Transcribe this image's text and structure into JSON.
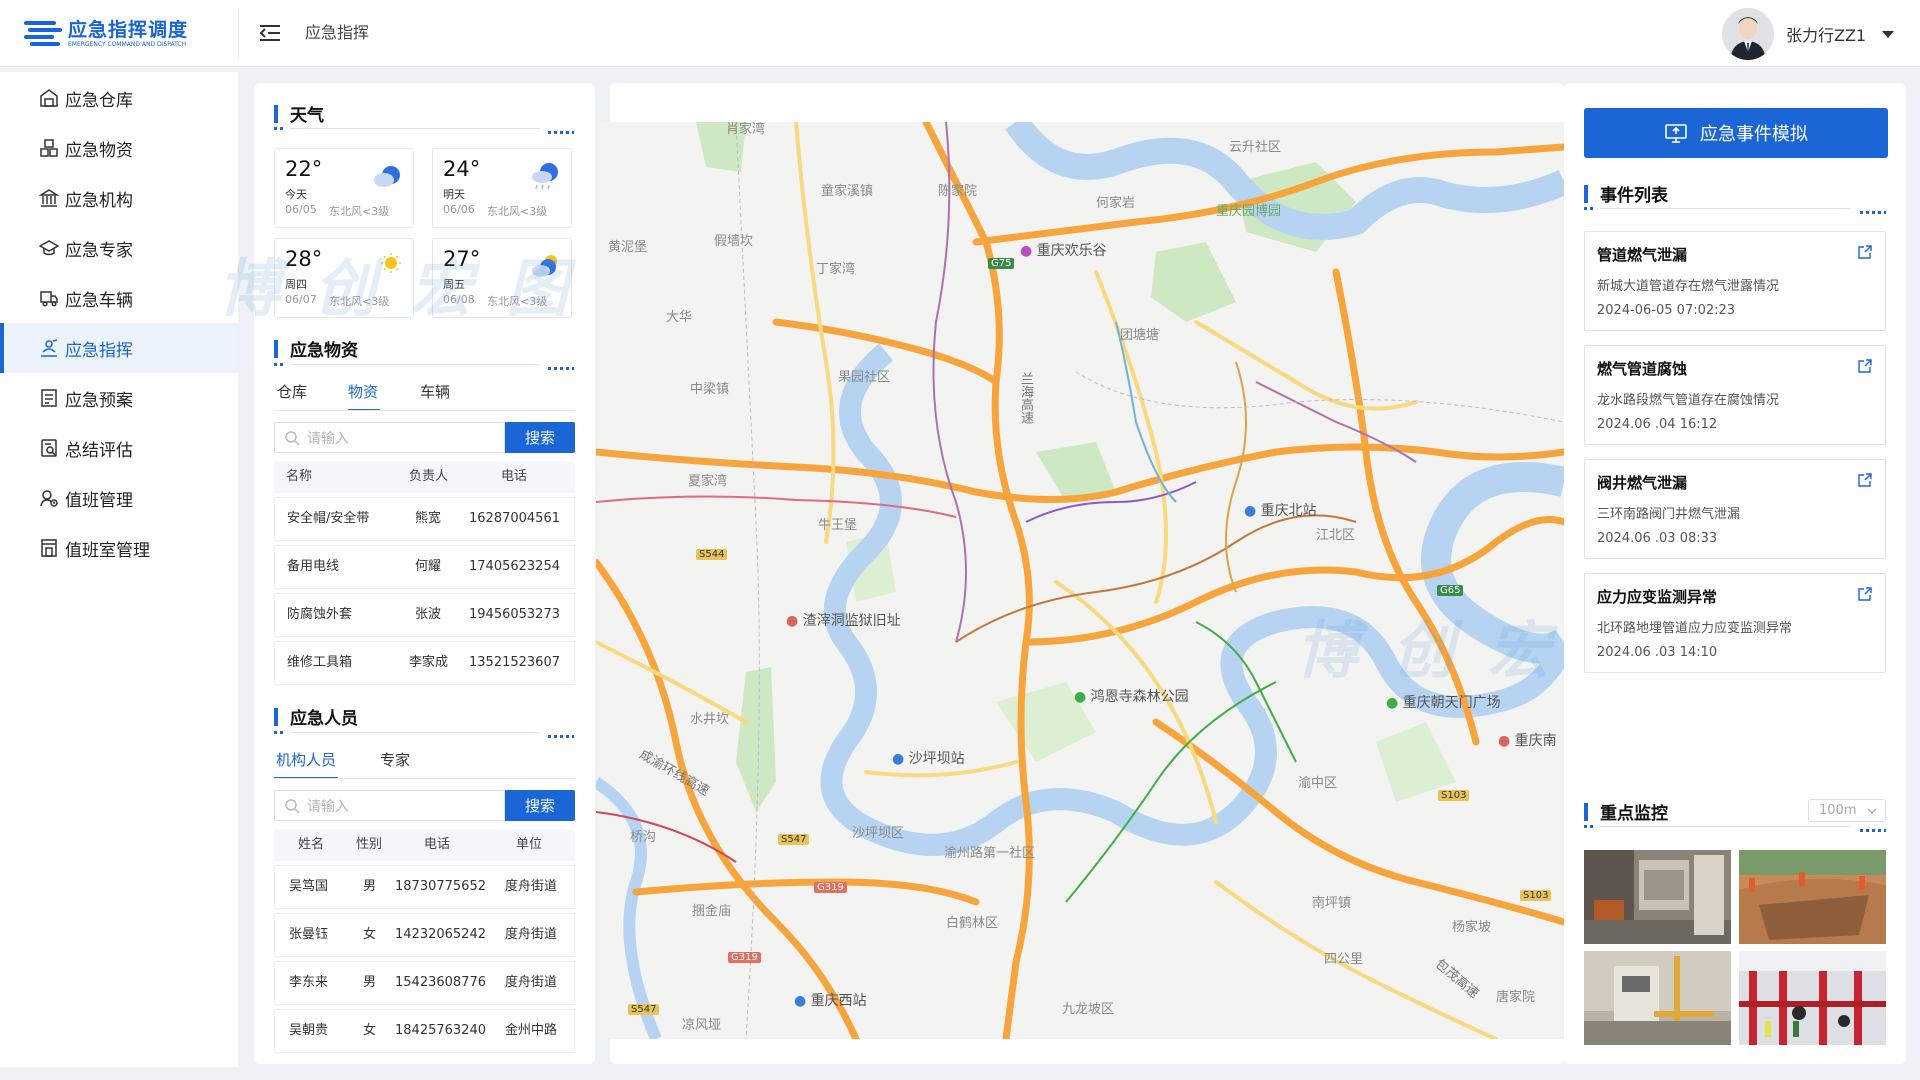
{
  "app": {
    "title": "应急指挥调度",
    "subtitle": "EMERGENCY COMMAND AND DISPATCH",
    "brand_color": "#1a66d6"
  },
  "header": {
    "breadcrumb": "应急指挥",
    "user_name": "张力行ZZ1"
  },
  "sidebar": {
    "items": [
      {
        "label": "应急仓库",
        "icon": "warehouse-icon"
      },
      {
        "label": "应急物资",
        "icon": "boxes-icon"
      },
      {
        "label": "应急机构",
        "icon": "institution-icon"
      },
      {
        "label": "应急专家",
        "icon": "expert-icon"
      },
      {
        "label": "应急车辆",
        "icon": "truck-icon"
      },
      {
        "label": "应急指挥",
        "icon": "commander-icon",
        "active": true
      },
      {
        "label": "应急预案",
        "icon": "plan-icon"
      },
      {
        "label": "总结评估",
        "icon": "evaluation-icon"
      },
      {
        "label": "值班管理",
        "icon": "duty-icon"
      },
      {
        "label": "值班室管理",
        "icon": "duty-room-icon"
      }
    ]
  },
  "weather": {
    "title": "天气",
    "cards": [
      {
        "temp": "22°",
        "day": "今天",
        "date": "06/05",
        "wind": "东北风<3级",
        "icon": "cloudy-icon"
      },
      {
        "temp": "24°",
        "day": "明天",
        "date": "06/06",
        "wind": "东北风<3级",
        "icon": "rain-icon"
      },
      {
        "temp": "28°",
        "day": "周四",
        "date": "06/07",
        "wind": "东北风<3级",
        "icon": "sunny-icon"
      },
      {
        "temp": "27°",
        "day": "周五",
        "date": "06/08",
        "wind": "东北风<3级",
        "icon": "partly-cloudy-icon"
      }
    ]
  },
  "supplies": {
    "title": "应急物资",
    "tabs": [
      "仓库",
      "物资",
      "车辆"
    ],
    "active_tab": 1,
    "search_placeholder": "请输入",
    "search_button": "搜索",
    "columns": [
      "名称",
      "负责人",
      "电话"
    ],
    "rows": [
      [
        "安全帽/安全带",
        "熊宽",
        "16287004561"
      ],
      [
        "备用电线",
        "何耀",
        "17405623254"
      ],
      [
        "防腐蚀外套",
        "张波",
        "19456053273"
      ],
      [
        "维修工具箱",
        "李家成",
        "13521523607"
      ]
    ]
  },
  "personnel": {
    "title": "应急人员",
    "tabs": [
      "机构人员",
      "专家"
    ],
    "active_tab": 0,
    "search_placeholder": "请输入",
    "search_button": "搜索",
    "columns": [
      "姓名",
      "性别",
      "电话",
      "单位"
    ],
    "rows": [
      [
        "吴笃国",
        "男",
        "18730775652",
        "度舟街道"
      ],
      [
        "张曼钰",
        "女",
        "14232065242",
        "度舟街道"
      ],
      [
        "李东来",
        "男",
        "15423608776",
        "度舟街道"
      ],
      [
        "吴朝贵",
        "女",
        "18425763240",
        "金州中路"
      ]
    ]
  },
  "map": {
    "labels": [
      "肖家湾",
      "童家溪镇",
      "陈家院",
      "何家岩",
      "云升社区",
      "假墙坎",
      "黄泥堡",
      "丁家湾",
      "大华",
      "团塘塘",
      "重庆园博园",
      "重庆欢乐谷",
      "果园社区",
      "中梁镇",
      "夏家湾",
      "重庆北站",
      "江北区",
      "牛王堡",
      "渣滓洞监狱旧址",
      "鸿恩寺森林公园",
      "重庆朝天门广场",
      "重庆南",
      "水井坎",
      "沙坪坝站",
      "成渝环线高速",
      "渝中区",
      "桥沟",
      "沙坪坝区",
      "渝州路第一社区",
      "南坪镇",
      "杨家坡",
      "捆金庙",
      "白鹤林区",
      "四公里",
      "重庆西站",
      "九龙坡区",
      "凉风垭",
      "唐家院",
      "包茂高速",
      "兰海高速"
    ],
    "road_shields": [
      "G75",
      "S544",
      "G65",
      "S547",
      "G319",
      "S103",
      "S103",
      "G319",
      "S547"
    ]
  },
  "simulate_button": "应急事件模拟",
  "events": {
    "title": "事件列表",
    "items": [
      {
        "title": "管道燃气泄漏",
        "desc": "新城大道管道存在燃气泄露情况",
        "time": "2024-06-05 07:02:23"
      },
      {
        "title": "燃气管道腐蚀",
        "desc": "龙水路段燃气管道存在腐蚀情况",
        "time": "2024.06 .04 16:12"
      },
      {
        "title": "阀井燃气泄漏",
        "desc": "三环南路阀门井燃气泄漏",
        "time": "2024.06 .03 08:33"
      },
      {
        "title": "应力应变监测异常",
        "desc": "北环路地埋管道应力应变监测异常",
        "time": "2024.06 .03 14:10"
      }
    ]
  },
  "monitoring": {
    "title": "重点监控",
    "range": "100m",
    "thumbs": [
      "monitor-room-image",
      "excavation-site-image",
      "gas-meter-image",
      "pipe-station-image"
    ]
  },
  "watermark": "博创宏图"
}
